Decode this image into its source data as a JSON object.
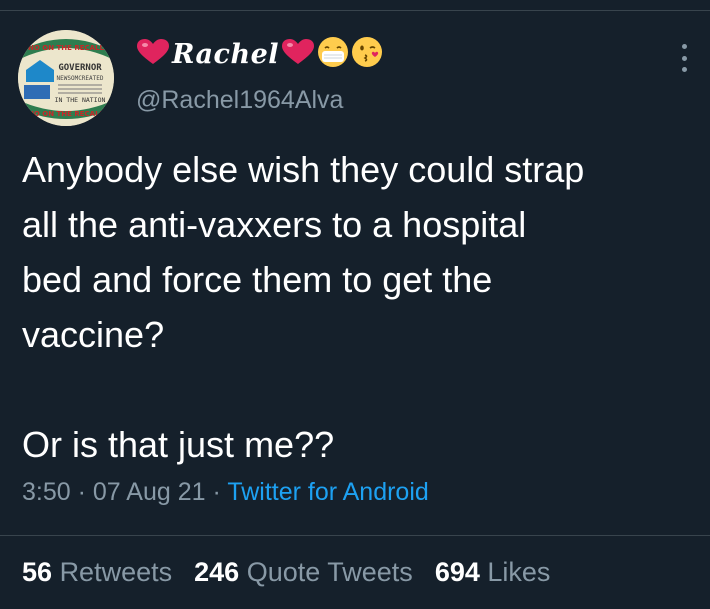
{
  "user": {
    "display_name": "Rachel",
    "handle": "@Rachel1964Alva",
    "avatar_text": {
      "line1": "NO ON THE RECALL",
      "line2": "GOVERNOR",
      "line3": "NEWSOMCREATED",
      "line4": "IN THE NATION",
      "line5": "NO ON THE RECALL"
    }
  },
  "tweet": {
    "text": "Anybody else wish they could strap\nall the anti-vaxxers to a hospital\nbed and force them to get the\nvaccine?\n\nOr is that just me??",
    "time": "3:50",
    "separator": "·",
    "date": "07 Aug 21",
    "source": "Twitter for Android"
  },
  "stats": {
    "retweets_count": "56",
    "retweets_label": "Retweets",
    "quotes_count": "246",
    "quotes_label": "Quote Tweets",
    "likes_count": "694",
    "likes_label": "Likes"
  },
  "colors": {
    "background": "#15202b",
    "primary_text": "#ffffff",
    "secondary_text": "#8899a6",
    "link": "#1da1f2",
    "heart": "#e0245e"
  },
  "icons": {
    "more": "more-vertical-icon",
    "heart": "red-heart-emoji",
    "mask": "face-with-medical-mask-emoji",
    "kiss": "face-blowing-kiss-emoji"
  }
}
